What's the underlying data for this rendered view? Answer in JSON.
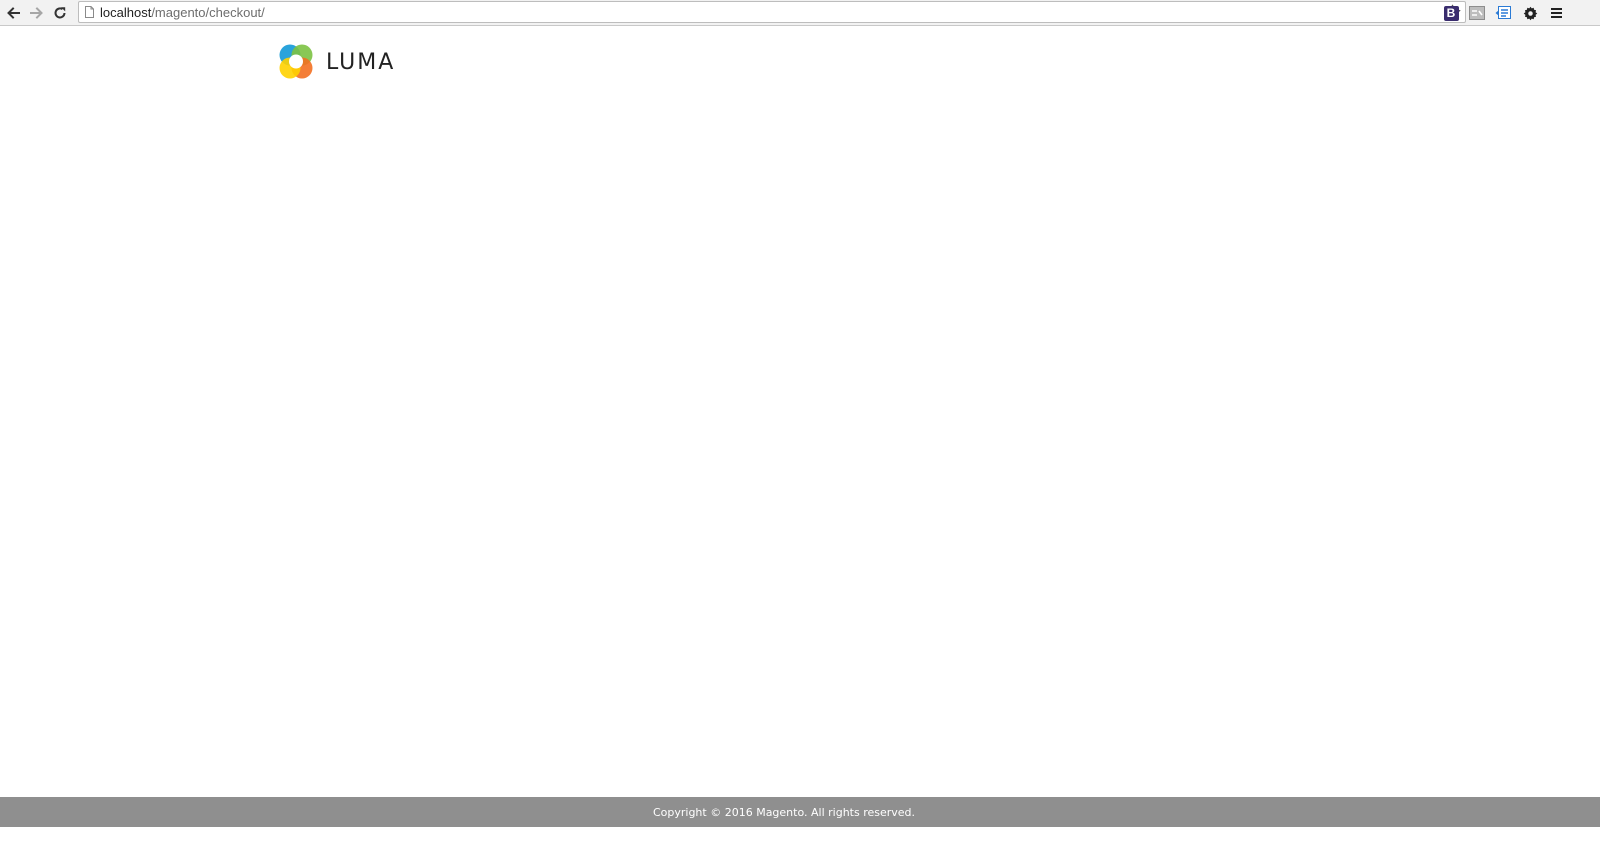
{
  "browser": {
    "url_host": "localhost",
    "url_path": "/magento/checkout/",
    "icons": {
      "back": "arrow-left-icon",
      "forward": "arrow-right-icon",
      "reload": "reload-icon",
      "page": "page-icon",
      "bookmark": "star-icon",
      "extension_b": "bootstrap-extension-icon",
      "extension_2": "extension-icon",
      "extension_3": "extension-icon",
      "settings": "gear-icon",
      "menu": "hamburger-menu-icon"
    },
    "extension_b_label": "B"
  },
  "header": {
    "logo_text": "LUMA",
    "logo_colors": [
      "#1f9ed9",
      "#7cc242",
      "#f37021",
      "#ffd200"
    ]
  },
  "footer": {
    "copyright": "Copyright © 2016 Magento. All rights reserved.",
    "background": "#8f8f8f"
  }
}
